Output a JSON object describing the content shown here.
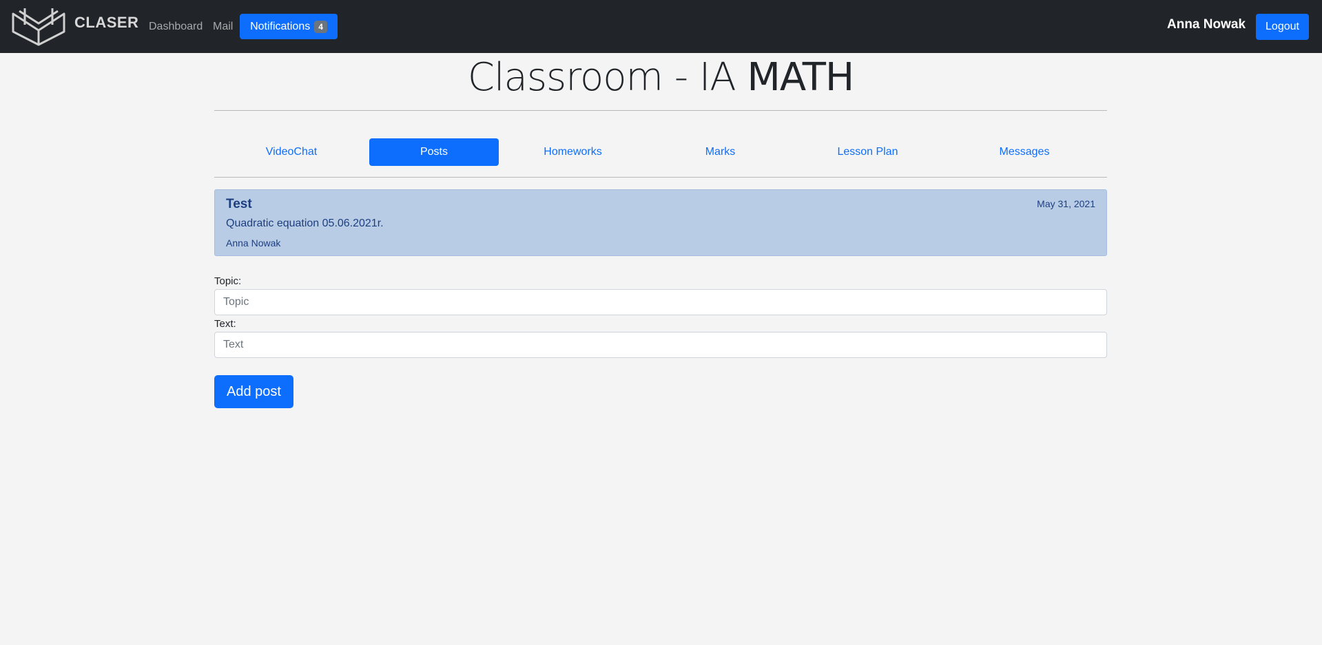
{
  "navbar": {
    "brand": "CLASER",
    "links": {
      "dashboard": "Dashboard",
      "mail": "Mail"
    },
    "notifications": {
      "label": "Notifications",
      "count": "4"
    },
    "user": "Anna Nowak",
    "logout": "Logout"
  },
  "page": {
    "title_prefix": "Classroom - IA",
    "title_subject": "MATH"
  },
  "tabs": [
    "VideoChat",
    "Posts",
    "Homeworks",
    "Marks",
    "Lesson Plan",
    "Messages"
  ],
  "active_tab": "Posts",
  "posts": [
    {
      "title": "Test",
      "date": "May 31, 2021",
      "text": "Quadratic equation 05.06.2021r.",
      "author": "Anna Nowak"
    }
  ],
  "form": {
    "topic_label": "Topic:",
    "topic_placeholder": "Topic",
    "text_label": "Text:",
    "text_placeholder": "Text",
    "submit": "Add post"
  },
  "colors": {
    "navbar_bg": "#212529",
    "accent": "#0d6efd",
    "post_bg": "#b9cce6",
    "page_bg": "#f4f4f4"
  }
}
